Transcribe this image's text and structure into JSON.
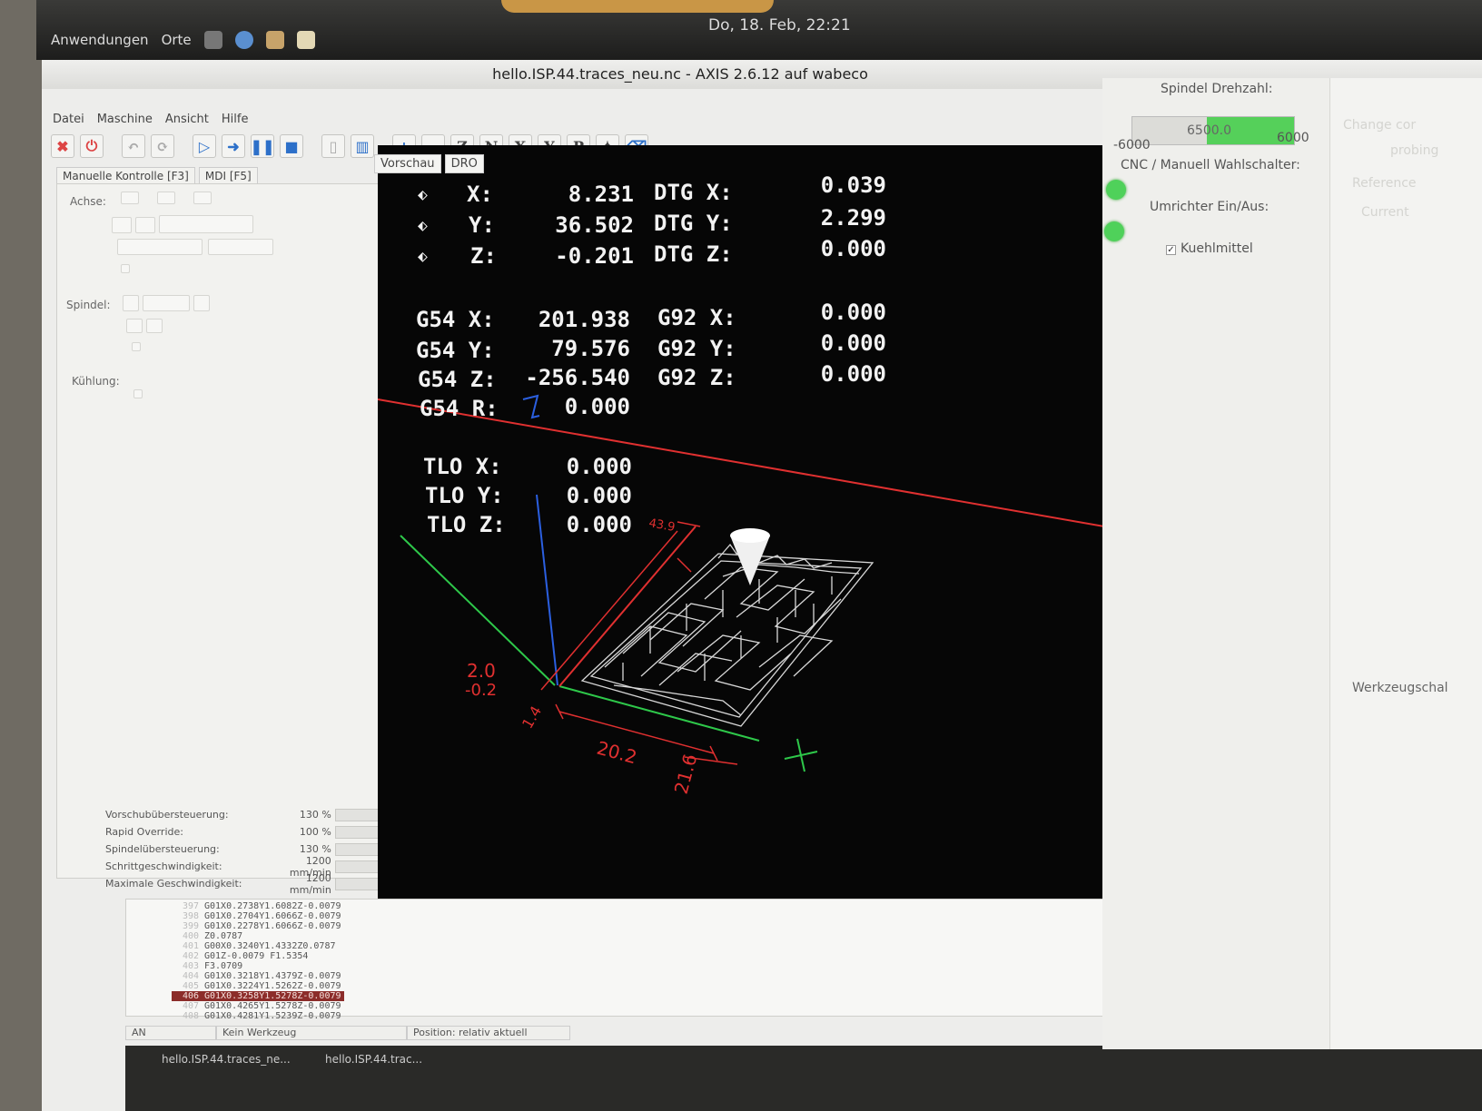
{
  "topbar": {
    "menu_apps": "Anwendungen",
    "menu_places": "Orte",
    "clock": "Do, 18. Feb, 22:21"
  },
  "window": {
    "title": "hello.ISP.44.traces_neu.nc - AXIS 2.6.12 auf  wabeco"
  },
  "menubar": [
    "Datei",
    "Maschine",
    "Ansicht",
    "Hilfe"
  ],
  "toolbar": {
    "axis_buttons": [
      "Z",
      "N",
      "X",
      "Y",
      "P"
    ]
  },
  "left_panel": {
    "tabs": [
      "Manuelle Kontrolle [F3]",
      "MDI [F5]"
    ],
    "label_axis": "Achse:",
    "label_spindle": "Spindel:",
    "label_cooling": "Kühlung:"
  },
  "overrides": [
    {
      "label": "Vorschubübersteuerung:",
      "value": "130 %"
    },
    {
      "label": "Rapid Override:",
      "value": "100 %"
    },
    {
      "label": "Spindelübersteuerung:",
      "value": "130 %"
    },
    {
      "label": "Schrittgeschwindigkeit:",
      "value": "1200 mm/min"
    },
    {
      "label": "Maximale Geschwindigkeit:",
      "value": "1200 mm/min"
    }
  ],
  "preview_tabs": [
    "Vorschau",
    "DRO"
  ],
  "dro": {
    "pos": [
      {
        "axis": "X:",
        "value": "8.231"
      },
      {
        "axis": "Y:",
        "value": "36.502"
      },
      {
        "axis": "Z:",
        "value": "-0.201"
      }
    ],
    "dtg": [
      {
        "label": "DTG X:",
        "value": "0.039"
      },
      {
        "label": "DTG Y:",
        "value": "2.299"
      },
      {
        "label": "DTG Z:",
        "value": "0.000"
      }
    ],
    "g54": [
      {
        "label": "G54 X:",
        "value": "201.938"
      },
      {
        "label": "G54 Y:",
        "value": "79.576"
      },
      {
        "label": "G54 Z:",
        "value": "-256.540"
      },
      {
        "label": "G54 R:",
        "value": "0.000"
      }
    ],
    "g92": [
      {
        "label": "G92 X:",
        "value": "0.000"
      },
      {
        "label": "G92 Y:",
        "value": "0.000"
      },
      {
        "label": "G92 Z:",
        "value": "0.000"
      }
    ],
    "tlo": [
      {
        "label": "TLO X:",
        "value": "0.000"
      },
      {
        "label": "TLO Y:",
        "value": "0.000"
      },
      {
        "label": "TLO Z:",
        "value": "0.000"
      }
    ]
  },
  "preview_dims": {
    "x_len": "20.2",
    "y_len": "21.6",
    "min_y": "1.4",
    "z_top": "2.0",
    "z_bot": "-0.2",
    "extra": "43.9"
  },
  "code_lines": [
    {
      "n": "397",
      "code": "G01X0.2738Y1.6082Z-0.0079"
    },
    {
      "n": "398",
      "code": "G01X0.2704Y1.6066Z-0.0079"
    },
    {
      "n": "399",
      "code": "G01X0.2278Y1.6066Z-0.0079"
    },
    {
      "n": "400",
      "code": "Z0.0787"
    },
    {
      "n": "401",
      "code": "G00X0.3240Y1.4332Z0.0787"
    },
    {
      "n": "402",
      "code": "G01Z-0.0079 F1.5354"
    },
    {
      "n": "403",
      "code": "F3.0709"
    },
    {
      "n": "404",
      "code": "G01X0.3218Y1.4379Z-0.0079"
    },
    {
      "n": "405",
      "code": "G01X0.3224Y1.5262Z-0.0079"
    },
    {
      "n": "406",
      "code": "G01X0.3258Y1.5278Z-0.0079"
    },
    {
      "n": "407",
      "code": "G01X0.4265Y1.5278Z-0.0079"
    },
    {
      "n": "408",
      "code": "G01X0.4281Y1.5239Z-0.0079"
    }
  ],
  "active_line_index": 9,
  "status": {
    "state": "AN",
    "tool": "Kein Werkzeug",
    "position": "Position: relativ aktuell"
  },
  "taskbar": {
    "item1": "hello.ISP.44.traces_ne...",
    "item2": "hello.ISP.44.trac..."
  },
  "right_panel": {
    "spindle_title": "Spindel Drehzahl:",
    "spindle_value": "6500.0",
    "spindle_fraction": 0.54,
    "scale_min": "-6000",
    "scale_max": "6000",
    "cnc_switch_label": "CNC / Manuell Wahlschalter:",
    "inverter_label": "Umrichter Ein/Aus:",
    "coolant_label": "Kuehlmittel",
    "tool_changer_label": "Werkzeugschal"
  },
  "far_right": {
    "faded_1": "Change cor",
    "faded_2": "probing",
    "faded_3": "Reference",
    "faded_4": "Current"
  },
  "colors": {
    "canvas_bg": "#060606",
    "dro_text": "#f2f2f2",
    "axis_red": "#e03030",
    "axis_green": "#2ec84a",
    "axis_blue": "#2b5fe0",
    "led_green": "#4fd15a",
    "active_line": "#8c2d2a"
  }
}
